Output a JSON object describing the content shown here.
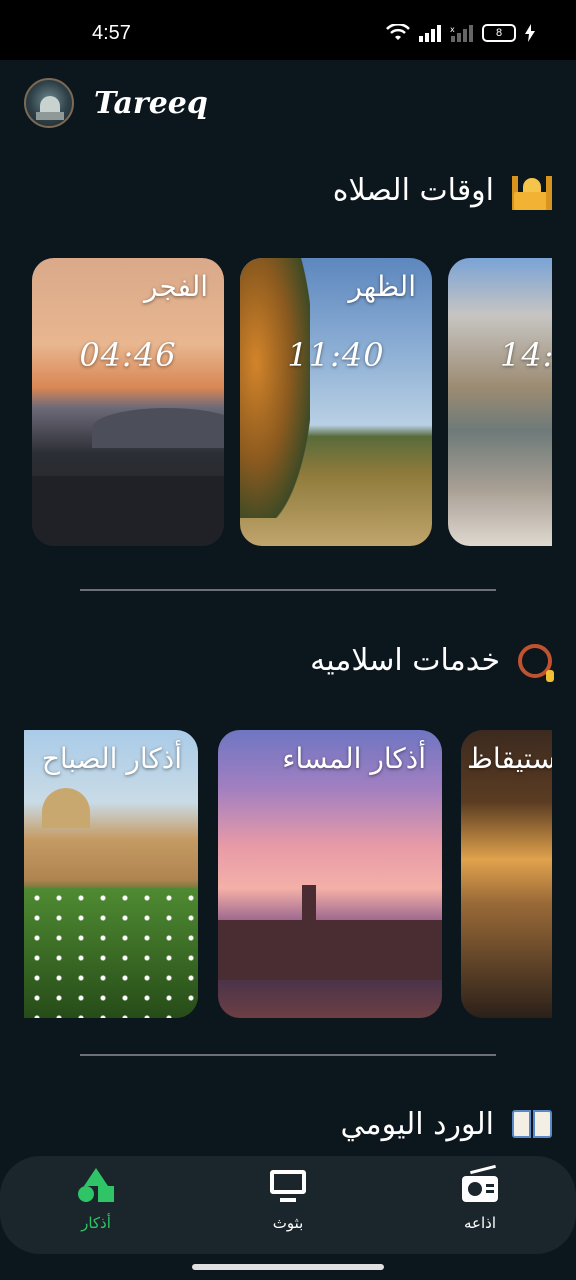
{
  "status_bar": {
    "time": "4:57",
    "battery": "8"
  },
  "app": {
    "title": "Tareeq"
  },
  "prayer_section": {
    "title": "اوقات الصلاه",
    "icon": "mosque-icon",
    "cards": [
      {
        "name": "الفجر",
        "time": "04:46"
      },
      {
        "name": "الظهر",
        "time": "11:40"
      },
      {
        "name": "",
        "time": "14:"
      }
    ]
  },
  "services_section": {
    "title": "خدمات اسلاميه",
    "icon": "prayer-beads-icon",
    "cards": [
      {
        "name": "أذكار الصباح"
      },
      {
        "name": "أذكار المساء"
      },
      {
        "name": "ستيقاظ"
      }
    ]
  },
  "daily_section": {
    "title": "الورد اليومي",
    "icon": "open-book-icon"
  },
  "bottom_nav": {
    "items": [
      {
        "label": "أذكار",
        "icon": "shapes-icon",
        "active": true
      },
      {
        "label": "بثوث",
        "icon": "tv-icon",
        "active": false
      },
      {
        "label": "اذاعه",
        "icon": "radio-icon",
        "active": false
      }
    ]
  },
  "colors": {
    "background": "#0c161d",
    "nav_background": "#1b252c",
    "accent": "#2fc566"
  }
}
